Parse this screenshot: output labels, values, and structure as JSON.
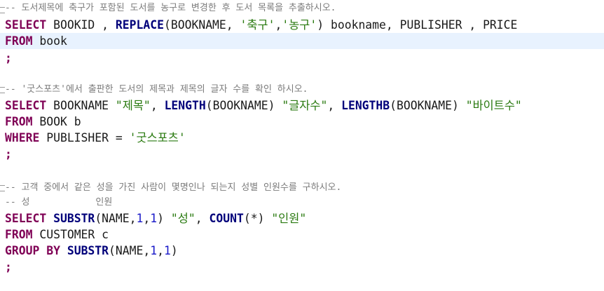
{
  "editor": {
    "lines": {
      "l1": {
        "c1": "-- 도서제목에 축구가 포함된 도서를 농구로 변경한 후 도서 목록을 추출하시오."
      },
      "l2": {
        "t1": "SELECT",
        "t2": " BOOKID , ",
        "t3": "REPLACE",
        "t4": "(BOOKNAME, ",
        "t5": "'축구'",
        "t6": ",",
        "t7": "'농구'",
        "t8": ") bookname, PUBLISHER , PRICE"
      },
      "l3": {
        "t1": "FROM",
        "t2": " book"
      },
      "l4": {
        "t1": ";"
      },
      "l6": {
        "c1": "-- '굿스포츠'에서 출판한 도서의 제목과 제목의 글자 수를 확인 하시오."
      },
      "l7": {
        "t1": "SELECT",
        "t2": " BOOKNAME ",
        "t3": "\"제목\"",
        "t4": ", ",
        "t5": "LENGTH",
        "t6": "(BOOKNAME) ",
        "t7": "\"글자수\"",
        "t8": ", ",
        "t9": "LENGTHB",
        "t10": "(BOOKNAME) ",
        "t11": "\"바이트수\""
      },
      "l8": {
        "t1": "FROM",
        "t2": " BOOK b"
      },
      "l9": {
        "t1": "WHERE",
        "t2": " PUBLISHER = ",
        "t3": "'굿스포츠'"
      },
      "l10": {
        "t1": ";"
      },
      "l12": {
        "c1": "-- 고객 중에서 같은 성을 가진 사람이 몇명인나 되는지 성별 인원수를 구하시오."
      },
      "l13": {
        "c1": "-- 성            인원"
      },
      "l14": {
        "t1": "SELECT",
        "t2": " ",
        "t3": "SUBSTR",
        "t4": "(NAME,",
        "t5": "1",
        "t6": ",",
        "t7": "1",
        "t8": ") ",
        "t9": "\"성\"",
        "t10": ", ",
        "t11": "COUNT",
        "t12": "(*) ",
        "t13": "\"인원\""
      },
      "l15": {
        "t1": "FROM",
        "t2": " CUSTOMER c"
      },
      "l16": {
        "t1": "GROUP BY",
        "t2": " ",
        "t3": "SUBSTR",
        "t4": "(NAME,",
        "t5": "1",
        "t6": ",",
        "t7": "1",
        "t8": ")"
      },
      "l17": {
        "t1": ";"
      }
    }
  }
}
